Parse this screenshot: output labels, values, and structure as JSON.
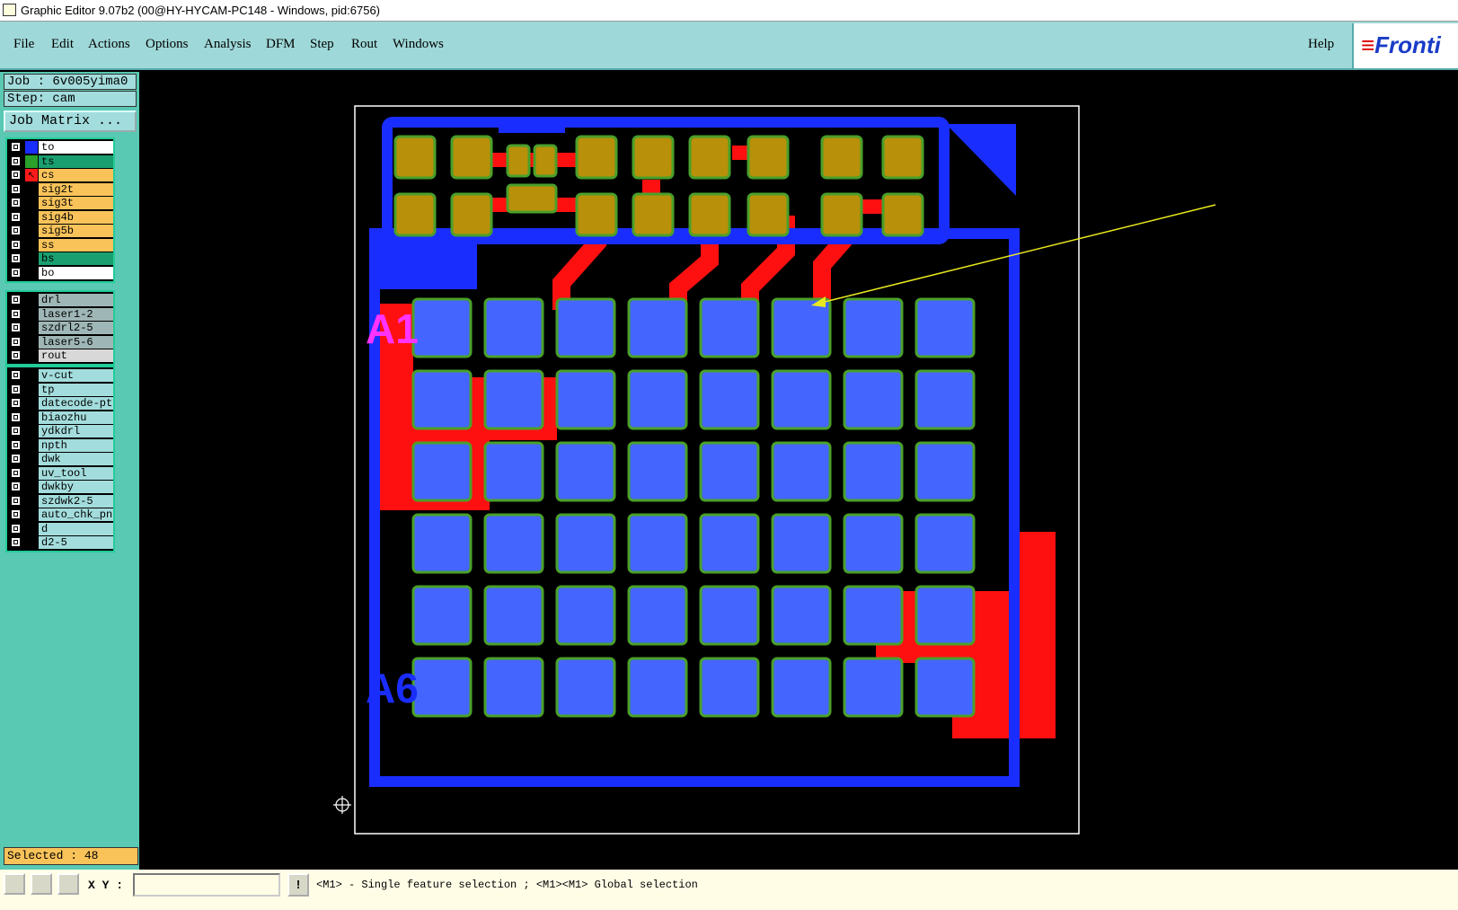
{
  "window": {
    "title": "Graphic Editor 9.07b2 (00@HY-HYCAM-PC148 - Windows, pid:6756)"
  },
  "menu": {
    "items": [
      "File",
      "Edit",
      "Actions",
      "Options",
      "Analysis",
      "DFM",
      "Step",
      "Rout",
      "Windows"
    ],
    "help": "Help",
    "brand": "Fronti"
  },
  "job": {
    "job_label": "Job : 6v005yima0",
    "step_label": "Step: cam",
    "matrix_button": "Job Matrix ..."
  },
  "layers": {
    "board": [
      {
        "name": "to",
        "color": "#ffffff",
        "swatch": "#1a2dff"
      },
      {
        "name": "ts",
        "color": "#1aa070",
        "swatch": "#2aa02a"
      },
      {
        "name": "cs",
        "color": "#f9c35a",
        "swatch": "#ff1a1a",
        "active": true
      },
      {
        "name": "sig2t",
        "color": "#f9c35a",
        "swatch": ""
      },
      {
        "name": "sig3t",
        "color": "#f9c35a",
        "swatch": ""
      },
      {
        "name": "sig4b",
        "color": "#f9c35a",
        "swatch": ""
      },
      {
        "name": "sig5b",
        "color": "#f9c35a",
        "swatch": ""
      },
      {
        "name": "ss",
        "color": "#f9c35a",
        "swatch": ""
      },
      {
        "name": "bs",
        "color": "#1aa070",
        "swatch": ""
      },
      {
        "name": "bo",
        "color": "#ffffff",
        "swatch": ""
      }
    ],
    "drill": [
      {
        "name": "drl",
        "color": "#9fb6b6",
        "swatch": ""
      },
      {
        "name": "laser1-2",
        "color": "#9fb6b6",
        "swatch": ""
      },
      {
        "name": "szdrl2-5",
        "color": "#9fb6b6",
        "swatch": ""
      },
      {
        "name": "laser5-6",
        "color": "#9fb6b6",
        "swatch": ""
      },
      {
        "name": "rout",
        "color": "#d8d8d8",
        "swatch": ""
      }
    ],
    "misc": [
      {
        "name": "v-cut",
        "color": "#a3dcdc",
        "swatch": ""
      },
      {
        "name": "tp",
        "color": "#a3dcdc",
        "swatch": ""
      },
      {
        "name": "datecode-pte",
        "color": "#a3dcdc",
        "swatch": ""
      },
      {
        "name": "biaozhu",
        "color": "#a3dcdc",
        "swatch": ""
      },
      {
        "name": "ydkdrl",
        "color": "#a3dcdc",
        "swatch": ""
      },
      {
        "name": "npth",
        "color": "#a3dcdc",
        "swatch": ""
      },
      {
        "name": "dwk",
        "color": "#a3dcdc",
        "swatch": ""
      },
      {
        "name": "uv_tool",
        "color": "#a3dcdc",
        "swatch": ""
      },
      {
        "name": "dwkby",
        "color": "#a3dcdc",
        "swatch": ""
      },
      {
        "name": "szdwk2-5",
        "color": "#a3dcdc",
        "swatch": ""
      },
      {
        "name": "auto_chk_pnl",
        "color": "#a3dcdc",
        "swatch": ""
      },
      {
        "name": "d",
        "color": "#a3dcdc",
        "swatch": ""
      },
      {
        "name": "d2-5",
        "color": "#a3dcdc",
        "swatch": ""
      }
    ]
  },
  "canvas": {
    "label_a1": "A1",
    "label_a6": "A6"
  },
  "status": {
    "selected": "Selected : 48",
    "xy_label": "X Y :",
    "xy_value": "",
    "warn": "!",
    "hint": "<M1> - Single feature selection ; <M1><M1> Global selection"
  }
}
